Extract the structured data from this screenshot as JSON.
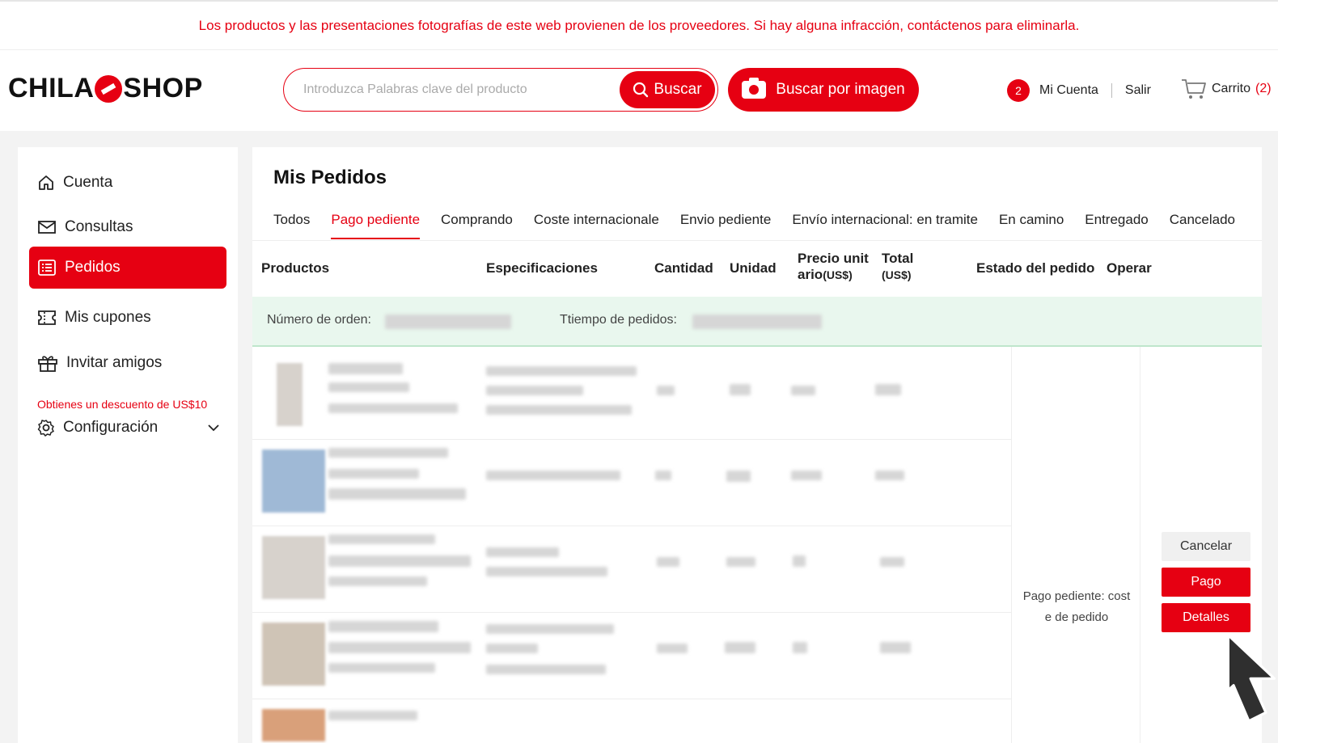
{
  "notice": "Los productos y las presentaciones fotografías de este web provienen de los proveedores. Si hay alguna infracción, contáctenos para eliminarla.",
  "header": {
    "logo_left": "CHILA",
    "logo_right": "SHOP",
    "search_placeholder": "Introduzca Palabras clave del producto",
    "search_button": "Buscar",
    "image_search_button": "Buscar por imagen",
    "notification_count": "2",
    "account_label": "Mi Cuenta",
    "logout_label": "Salir",
    "cart_label": "Carrito",
    "cart_count": "(2)"
  },
  "sidebar": {
    "items": [
      {
        "label": "Cuenta",
        "icon": "home-icon"
      },
      {
        "label": "Consultas",
        "icon": "mail-icon"
      },
      {
        "label": "Pedidos",
        "icon": "list-icon",
        "active": true
      },
      {
        "label": "Mis cupones",
        "icon": "coupon-icon"
      },
      {
        "label": "Invitar amigos",
        "icon": "gift-icon"
      },
      {
        "label": "Configuración",
        "icon": "settings-icon"
      }
    ],
    "invite_sub": "Obtienes un descuento de US$10"
  },
  "main": {
    "title": "Mis Pedidos",
    "tabs": [
      "Todos",
      "Pago pediente",
      "Comprando",
      "Coste internacionale",
      "Envio pediente",
      "Envío internacional: en tramite",
      "En camino",
      "Entregado",
      "Cancelado"
    ],
    "active_tab": "Pago pediente",
    "columns": {
      "products": "Productos",
      "specs": "Especificaciones",
      "qty": "Cantidad",
      "unit": "Unidad",
      "price_line1": "Precio unit",
      "price_line2": "ario",
      "price_unit": "(US$)",
      "total": "Total",
      "total_unit": "(US$)",
      "status": "Estado del pedido",
      "operate": "Operar"
    },
    "order_number_label": "Número de orden:",
    "order_time_label": "Ttiempo de pedidos:",
    "status_text_1": "Pago pediente: cost",
    "status_text_2": "e de pedido",
    "buttons": {
      "cancel": "Cancelar",
      "pay": "Pago",
      "details": "Detalles"
    }
  },
  "colors": {
    "accent": "#e60012",
    "order_bar": "#e9f7ee"
  }
}
